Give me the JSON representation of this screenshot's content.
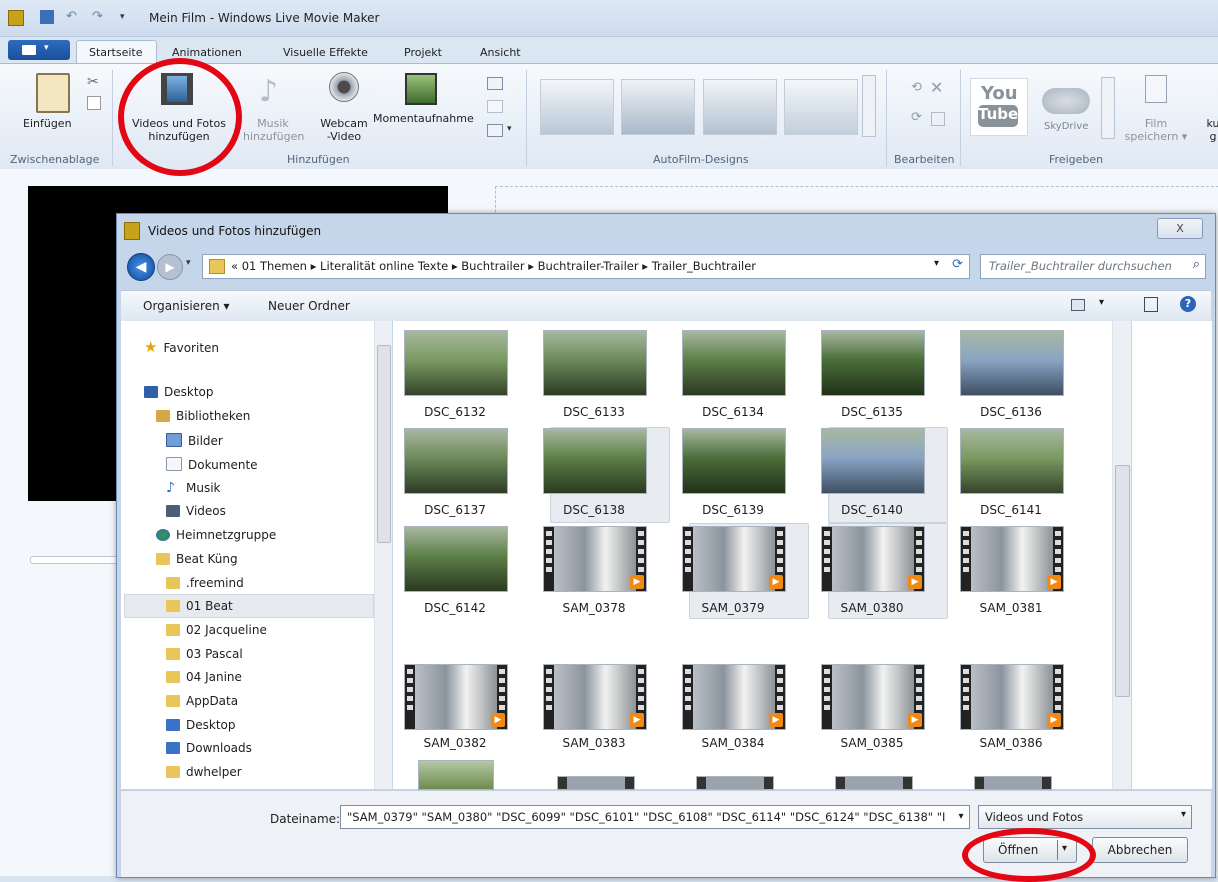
{
  "window": {
    "title": "Mein Film - Windows Live Movie Maker"
  },
  "ribbon": {
    "tabs": [
      "Startseite",
      "Animationen",
      "Visuelle Effekte",
      "Projekt",
      "Ansicht"
    ],
    "paste_label": "Einfügen",
    "add_videos_label": [
      "Videos und Fotos",
      "hinzufügen"
    ],
    "music_label": [
      "Musik",
      "hinzufügen"
    ],
    "webcam_label": [
      "Webcam",
      "-Video"
    ],
    "snapshot_label": "Momentaufnahme",
    "groups": {
      "clipboard": "Zwischenablage",
      "add": "Hinzufügen",
      "autofilm": "AutoFilm-Designs",
      "edit": "Bearbeiten",
      "share": "Freigeben"
    },
    "youtube_label": [
      "You",
      "Tube"
    ],
    "skydrive_label": "SkyDrive",
    "save_film_label": [
      "Film",
      "speichern"
    ],
    "cut_label": [
      "ku",
      "g"
    ]
  },
  "dialog": {
    "title": "Videos und Fotos hinzufügen",
    "close_label": "X",
    "breadcrumb": [
      "«",
      "01 Themen",
      "Literalität online Texte",
      "Buchtrailer",
      "Buchtrailer-Trailer",
      "Trailer_Buchtrailer"
    ],
    "search_placeholder": "Trailer_Buchtrailer durchsuchen",
    "toolbar": {
      "organize": "Organisieren",
      "new_folder": "Neuer Ordner"
    },
    "nav": [
      {
        "label": "Favoriten",
        "icon": "star-icon"
      },
      {
        "label": "Desktop",
        "icon": "desktop-icon"
      },
      {
        "label": "Bibliotheken",
        "icon": "library-icon"
      },
      {
        "label": "Bilder",
        "icon": "pictures-icon"
      },
      {
        "label": "Dokumente",
        "icon": "documents-icon"
      },
      {
        "label": "Musik",
        "icon": "music-icon"
      },
      {
        "label": "Videos",
        "icon": "videos-icon"
      },
      {
        "label": "Heimnetzgruppe",
        "icon": "homegroup-icon"
      },
      {
        "label": "Beat Küng",
        "icon": "user-folder-icon"
      },
      {
        "label": ".freemind",
        "icon": "folder-icon"
      },
      {
        "label": "01 Beat",
        "icon": "folder-icon"
      },
      {
        "label": "02 Jacqueline",
        "icon": "folder-icon"
      },
      {
        "label": "03 Pascal",
        "icon": "folder-icon"
      },
      {
        "label": "04 Janine",
        "icon": "folder-icon"
      },
      {
        "label": "AppData",
        "icon": "folder-icon"
      },
      {
        "label": "Desktop",
        "icon": "folder-icon"
      },
      {
        "label": "Downloads",
        "icon": "downloads-icon"
      },
      {
        "label": "dwhelper",
        "icon": "folder-icon"
      }
    ],
    "files": [
      [
        "DSC_6132",
        "DSC_6133",
        "DSC_6134",
        "DSC_6135",
        "DSC_6136"
      ],
      [
        "DSC_6137",
        "DSC_6138",
        "DSC_6139",
        "DSC_6140",
        "DSC_6141"
      ],
      [
        "DSC_6142",
        "SAM_0378",
        "SAM_0379",
        "SAM_0380",
        "SAM_0381"
      ],
      [
        "SAM_0382",
        "SAM_0383",
        "SAM_0384",
        "SAM_0385",
        "SAM_0386"
      ]
    ],
    "filename_label": "Dateiname:",
    "filename_value": "\"SAM_0379\" \"SAM_0380\" \"DSC_6099\" \"DSC_6101\" \"DSC_6108\" \"DSC_6114\" \"DSC_6124\" \"DSC_6138\" \"I",
    "filetype_value": "Videos und Fotos",
    "open_label": "Öffnen",
    "cancel_label": "Abbrechen"
  },
  "colors": {
    "highlight_ring": "#e30613",
    "accent": "#1b4f9b"
  }
}
